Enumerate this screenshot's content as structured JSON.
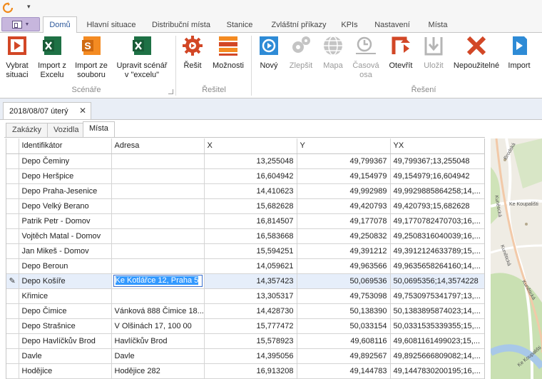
{
  "qat": {
    "app_icon": "refresh-icon",
    "menu_arrow": "▾"
  },
  "ribbon_tabs": [
    {
      "label": "Domů",
      "active": true
    },
    {
      "label": "Hlavní situace"
    },
    {
      "label": "Distribuční místa"
    },
    {
      "label": "Stanice"
    },
    {
      "label": "Zvláštní příkazy"
    },
    {
      "label": "KPIs"
    },
    {
      "label": "Nastavení"
    },
    {
      "label": "Místa"
    }
  ],
  "ribbon": {
    "scenare": {
      "group_label": "Scénáře",
      "buttons": [
        {
          "label_1": "Vybrat",
          "label_2": "situaci",
          "icon": "play-icon"
        },
        {
          "label_1": "Import z",
          "label_2": "Excelu",
          "icon": "excel-icon"
        },
        {
          "label_1": "Import ze",
          "label_2": "souboru",
          "icon": "file-import-icon"
        },
        {
          "label_1": "Upravit scénář",
          "label_2": "v \"excelu\"",
          "icon": "excel-edit-icon"
        }
      ]
    },
    "resitel": {
      "group_label": "Řešitel",
      "buttons": [
        {
          "label_1": "Řešit",
          "label_2": "",
          "icon": "gear-icon"
        },
        {
          "label_1": "Možnosti",
          "label_2": "",
          "icon": "options-icon"
        }
      ]
    },
    "reseni": {
      "group_label": "Řešení",
      "buttons": [
        {
          "label_1": "Nový",
          "label_2": "",
          "icon": "new-solution-icon",
          "disabled": false
        },
        {
          "label_1": "Zlepšit",
          "label_2": "",
          "icon": "gears-icon",
          "disabled": true
        },
        {
          "label_1": "Mapa",
          "label_2": "",
          "icon": "globe-icon",
          "disabled": true
        },
        {
          "label_1": "Časová",
          "label_2": "osa",
          "icon": "timeline-icon",
          "disabled": true
        },
        {
          "label_1": "Otevřít",
          "label_2": "",
          "icon": "open-icon",
          "disabled": false
        },
        {
          "label_1": "Uložit",
          "label_2": "",
          "icon": "save-icon",
          "disabled": true
        },
        {
          "label_1": "Nepoužitelné",
          "label_2": "",
          "icon": "unusable-x-icon",
          "disabled": false
        },
        {
          "label_1": "Import",
          "label_2": "",
          "icon": "import-icon",
          "disabled": false
        }
      ]
    }
  },
  "document_tab": {
    "label": "2018/08/07 úterý",
    "close": "✕"
  },
  "inner_tabs": [
    {
      "label": "Zakázky"
    },
    {
      "label": "Vozidla"
    },
    {
      "label": "Místa",
      "active": true
    }
  ],
  "grid": {
    "columns": [
      "Identifikátor",
      "Adresa",
      "X",
      "Y",
      "YX"
    ],
    "rows": [
      [
        "Depo Čeminy",
        "",
        "13,255048",
        "49,799367",
        "49,799367;13,255048"
      ],
      [
        "Depo Heršpice",
        "",
        "16,604942",
        "49,154979",
        "49,154979;16,604942"
      ],
      [
        "Depo Praha-Jesenice",
        "",
        "14,410623",
        "49,992989",
        "49,9929885864258;14,..."
      ],
      [
        "Depo Velký Berano",
        "",
        "15,682628",
        "49,420793",
        "49,420793;15,682628"
      ],
      [
        "Patrik Petr - Domov",
        "",
        "16,814507",
        "49,177078",
        "49,1770782470703;16,..."
      ],
      [
        "Vojtěch Matal - Domov",
        "",
        "16,583668",
        "49,250832",
        "49,2508316040039;16,..."
      ],
      [
        "Jan Mikeš - Domov",
        "",
        "15,594251",
        "49,391212",
        "49,3912124633789;15,..."
      ],
      [
        "Depo Beroun",
        "",
        "14,059621",
        "49,963566",
        "49,9635658264160;14,..."
      ],
      [
        "Depo Košíře",
        "Ke Kotlářce 12, Praha 5",
        "14,357423",
        "50,069536",
        "50,0695356;14,3574228"
      ],
      [
        "Křimice",
        "",
        "13,305317",
        "49,753098",
        "49,7530975341797;13,..."
      ],
      [
        "Depo Čimice",
        "Vánková 888  Čimice 18...",
        "14,428730",
        "50,138390",
        "50,1383895874023;14,..."
      ],
      [
        "Depo Strašnice",
        "V Olšinách 17, 100 00",
        "15,777472",
        "50,033154",
        "50,0331535339355;15,..."
      ],
      [
        "Depo Havlíčkův Brod",
        "Havlíčkův Brod",
        "15,578923",
        "49,608116",
        "49,6081161499023;15,..."
      ],
      [
        "Davle",
        "Davle",
        "14,395056",
        "49,892567",
        "49,8925666809082;14,..."
      ],
      [
        "Hodějice",
        "Hodějice 282",
        "16,913208",
        "49,144783",
        "49,1447830200195;16,..."
      ]
    ],
    "selected_row": 8,
    "editing_cell": "Ke Kotlářce 12, Praha 5"
  },
  "map": {
    "labels": [
      "Brodská",
      "Kunětická",
      "Ke Koupališti",
      "Kunětická",
      "Kunětická",
      "Ke Koupališti"
    ]
  },
  "colors": {
    "accent": "#2b579a",
    "red": "#d24726",
    "green": "#1e7145",
    "orange": "#f48b22",
    "blue": "#2e8bd6",
    "disabled": "#b5b5b5",
    "selection": "#e6eefa"
  }
}
